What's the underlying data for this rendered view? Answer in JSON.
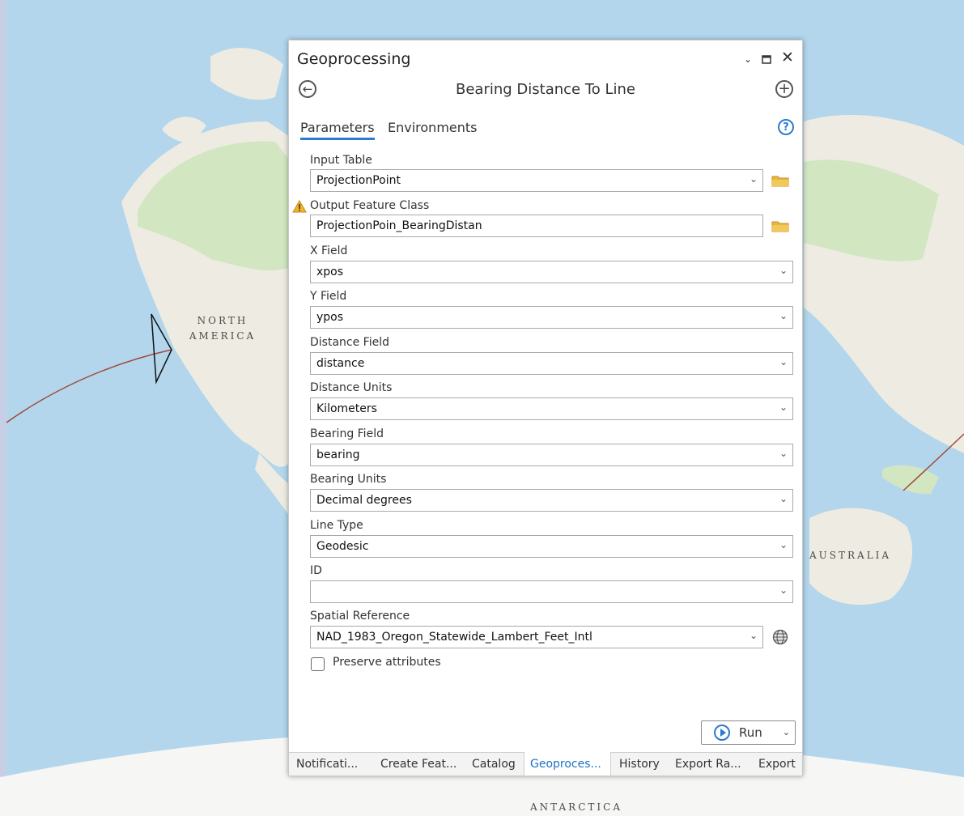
{
  "map": {
    "labels": {
      "north_america_1": "NORTH",
      "north_america_2": "AMERICA",
      "australia": "AUSTRALIA",
      "antarctica": "ANTARCTICA"
    },
    "colors": {
      "ocean": "#b3d6ec",
      "land": "#eeece2",
      "vegetation": "#d2e6c2",
      "line": "#a04a3a"
    }
  },
  "pane": {
    "title": "Geoprocessing",
    "tool_title": "Bearing Distance To Line",
    "tabs": {
      "parameters": "Parameters",
      "environments": "Environments"
    },
    "params": {
      "input_table": {
        "label": "Input Table",
        "value": "ProjectionPoint"
      },
      "output_fc": {
        "label": "Output Feature Class",
        "value": "ProjectionPoin_BearingDistan"
      },
      "x_field": {
        "label": "X Field",
        "value": "xpos"
      },
      "y_field": {
        "label": "Y Field",
        "value": "ypos"
      },
      "distance_field": {
        "label": "Distance Field",
        "value": "distance"
      },
      "distance_units": {
        "label": "Distance Units",
        "value": "Kilometers"
      },
      "bearing_field": {
        "label": "Bearing Field",
        "value": "bearing"
      },
      "bearing_units": {
        "label": "Bearing Units",
        "value": "Decimal degrees"
      },
      "line_type": {
        "label": "Line Type",
        "value": "Geodesic"
      },
      "id": {
        "label": "ID",
        "value": ""
      },
      "spatial_ref": {
        "label": "Spatial Reference",
        "value": "NAD_1983_Oregon_Statewide_Lambert_Feet_Intl"
      }
    },
    "preserve_label": "Preserve attributes",
    "run_label": "Run",
    "accent": "#2b7bd3"
  },
  "bottom_tabs": {
    "notifications": "Notificati...",
    "create_features": "Create Feat...",
    "catalog": "Catalog",
    "geoprocessing": "Geoproces...",
    "history": "History",
    "export_raster": "Export Ra...",
    "export": "Export"
  }
}
